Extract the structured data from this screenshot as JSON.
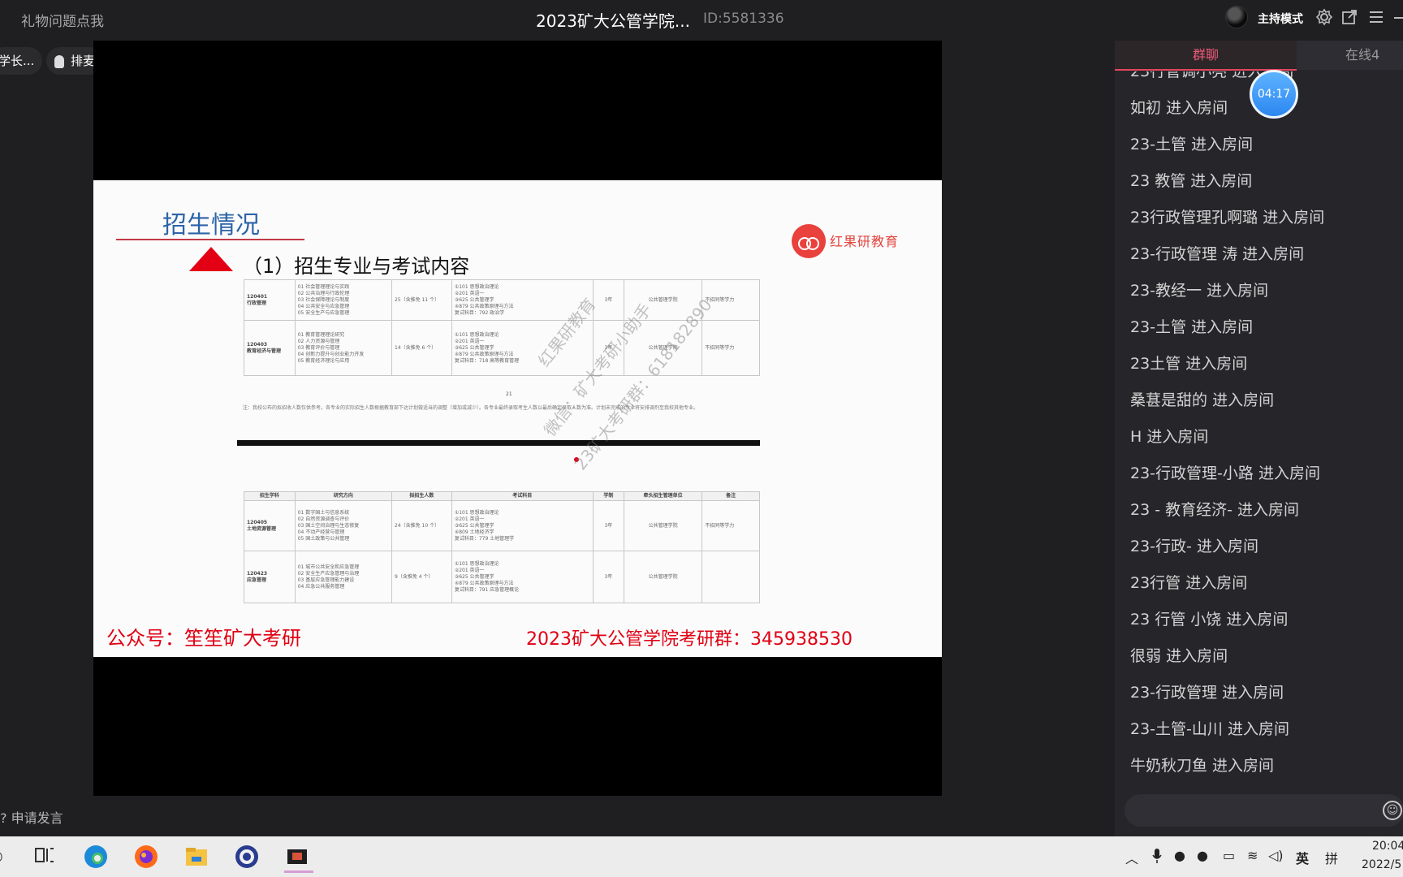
{
  "top_bar": {
    "gift_text": "礼物问题点我",
    "room_title": "2023矿大公管学院...",
    "room_id": "ID:5581336",
    "host_mode": "主持模式"
  },
  "pills": {
    "left_label": "学长...",
    "queue_label": "排麦"
  },
  "slide": {
    "title": "招生情况",
    "subtitle": "（1）招生专业与考试内容",
    "brand": "红果研教育",
    "table_top": [
      {
        "code": "120401",
        "name": "行政管理",
        "directions": "01 社会管理理论与实践\n02 公共治理与行政伦理\n03 社会保障理论与制度\n04 公共安全与应急管理\n05 安全生产与应急管理",
        "quota": "25（含推免 11 个）",
        "exam": "①101 思想政治理论\n②201 英语一\n③625 公共管理学\n④879 公共政策原理与方法\n复试科目：792 政治学",
        "years": "3年",
        "unit": "公共管理学院",
        "note": "不招同等学力"
      },
      {
        "code": "120403",
        "name": "教育经济与管理",
        "directions": "01 教育管理理论研究\n02 人力资源与管理\n03 教育评价与管理\n04 创新力提升与创业能力开发\n05 教育经济理论与应用",
        "quota": "14（含推免 6 个）",
        "exam": "①101 思想政治理论\n②201 英语一\n③625 公共管理学\n④879 公共政策原理与方法\n复试科目：718 高等教育管理",
        "years": "3年",
        "unit": "公共管理学院",
        "note": "不招同等学力"
      }
    ],
    "page_number": "21",
    "note_text": "注：我校公布的拟招收人数仅供参考。各专业的实际招生人数根据教育部下达计划做适当的调整（增加或减少）。各专业最终录取考生人数以最后确定录取人数为准。计划未完成的专业将安排调剂至我校其他专业。",
    "table_bottom_headers": [
      "招生学科",
      "研究方向",
      "拟招生人数",
      "考试科目",
      "学制",
      "牵头招生管理单位",
      "备注"
    ],
    "table_bottom": [
      {
        "code": "120405",
        "name": "土地资源管理",
        "directions": "01 数字国土与信息系统\n02 自然资源调查与评价\n03 国土空间治理与生态修复\n04 不动产经营与管理\n05 国土政策与公共管理",
        "quota": "24（含推免 10 个）",
        "exam": "①101 思想政治理论\n②201 英语一\n③625 公共管理学\n④809 土地经济学\n复试科目：779 土地管理学",
        "years": "3年",
        "unit": "公共管理学院",
        "note": "不招同等学力"
      },
      {
        "code": "120423",
        "name": "应急管理",
        "directions": "01 城市公共安全和应急管理\n02 安全生产应急管理与治理\n03 基层应急管理能力建设\n04 应急公共服务管理",
        "quota": "9（含推免 4 个）",
        "exam": "①101 思想政治理论\n②201 英语一\n③625 公共管理学\n④879 公共政策原理与方法\n复试科目：791 应急管理概论",
        "years": "3年",
        "unit": "公共管理学院",
        "note": ""
      }
    ],
    "watermark_1": "红果研教育",
    "watermark_2": "微信：矿大考研小助手",
    "watermark_3": "23矿大考研群：618182890",
    "footer_left": "公众号：笙笙矿大考研",
    "footer_right": "2023矿大公管学院考研群：345938530"
  },
  "raise_hand": "申请发言",
  "chat": {
    "tab_group": "群聊",
    "tab_online": "在线4",
    "timer": "04:17",
    "action_text": "进入房间",
    "messages": [
      {
        "user": "23行管调小亮"
      },
      {
        "user": "如初"
      },
      {
        "user": "23-土管"
      },
      {
        "user": "23 教管"
      },
      {
        "user": "23行政管理孔啊璐"
      },
      {
        "user": "23-行政管理 涛"
      },
      {
        "user": "23-教经一"
      },
      {
        "user": "23-土管"
      },
      {
        "user": "23土管"
      },
      {
        "user": "桑葚是甜的"
      },
      {
        "user": "H"
      },
      {
        "user": "23-行政管理-小路"
      },
      {
        "user": "23 - 教育经济-"
      },
      {
        "user": "23-行政-"
      },
      {
        "user": "23行管"
      },
      {
        "user": "23 行管 小饶"
      },
      {
        "user": "很弱"
      },
      {
        "user": "23-行政管理"
      },
      {
        "user": "23-土管-山川"
      },
      {
        "user": "牛奶秋刀鱼   "
      }
    ]
  },
  "taskbar": {
    "ime_lang": "英",
    "ime_mode": "拼",
    "time": "20:04",
    "date": "2022/5"
  }
}
